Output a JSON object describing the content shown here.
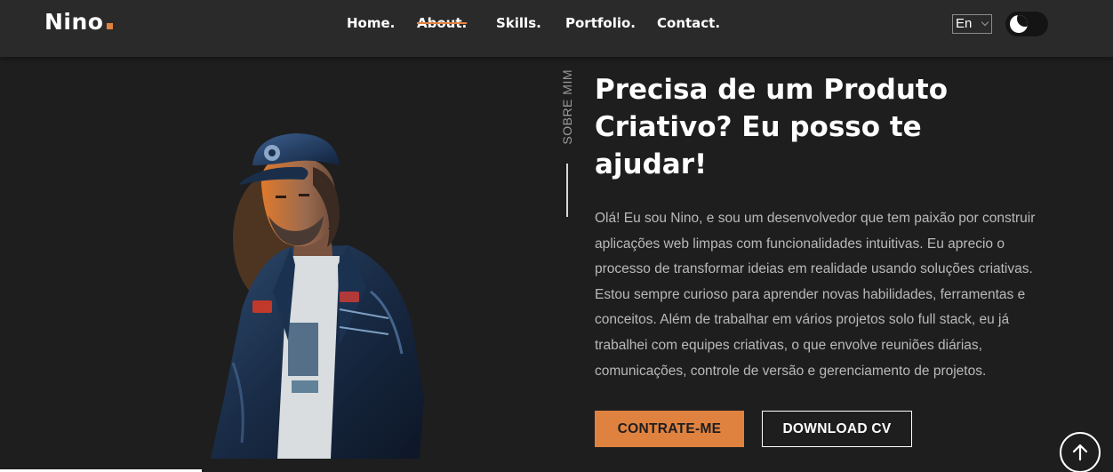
{
  "brand": {
    "name": "Nino",
    "accent": "#e0823f"
  },
  "nav": {
    "items": [
      {
        "label": "Home."
      },
      {
        "label": "About.",
        "active": true
      },
      {
        "label": "Skills."
      },
      {
        "label": "Portfolio."
      },
      {
        "label": "Contact."
      }
    ]
  },
  "language": {
    "selected": "En"
  },
  "theme": {
    "mode": "dark",
    "icon": "moon-icon"
  },
  "portrait": {
    "icon": "avatar-illustration"
  },
  "about": {
    "side_label": "SOBRE MIM",
    "headline": "Precisa de um Produto Criativo? Eu posso te ajudar!",
    "paragraph": "Olá! Eu sou Nino, e sou um desenvolvedor que tem paixão por construir aplicações web limpas com funcionalidades intuitivas. Eu aprecio o processo de transformar ideias em realidade usando soluções criativas. Estou sempre curioso para aprender novas habilidades, ferramentas e conceitos. Além de trabalhar em vários projetos solo full stack, eu já trabalhei com equipes criativas, o que envolve reuniões diárias, comunicações, controle de versão e gerenciamento de projetos.",
    "hire_label": "CONTRATE-ME",
    "cv_label": "DOWNLOAD CV"
  },
  "scroll_top": {
    "icon": "arrow-up-icon"
  }
}
